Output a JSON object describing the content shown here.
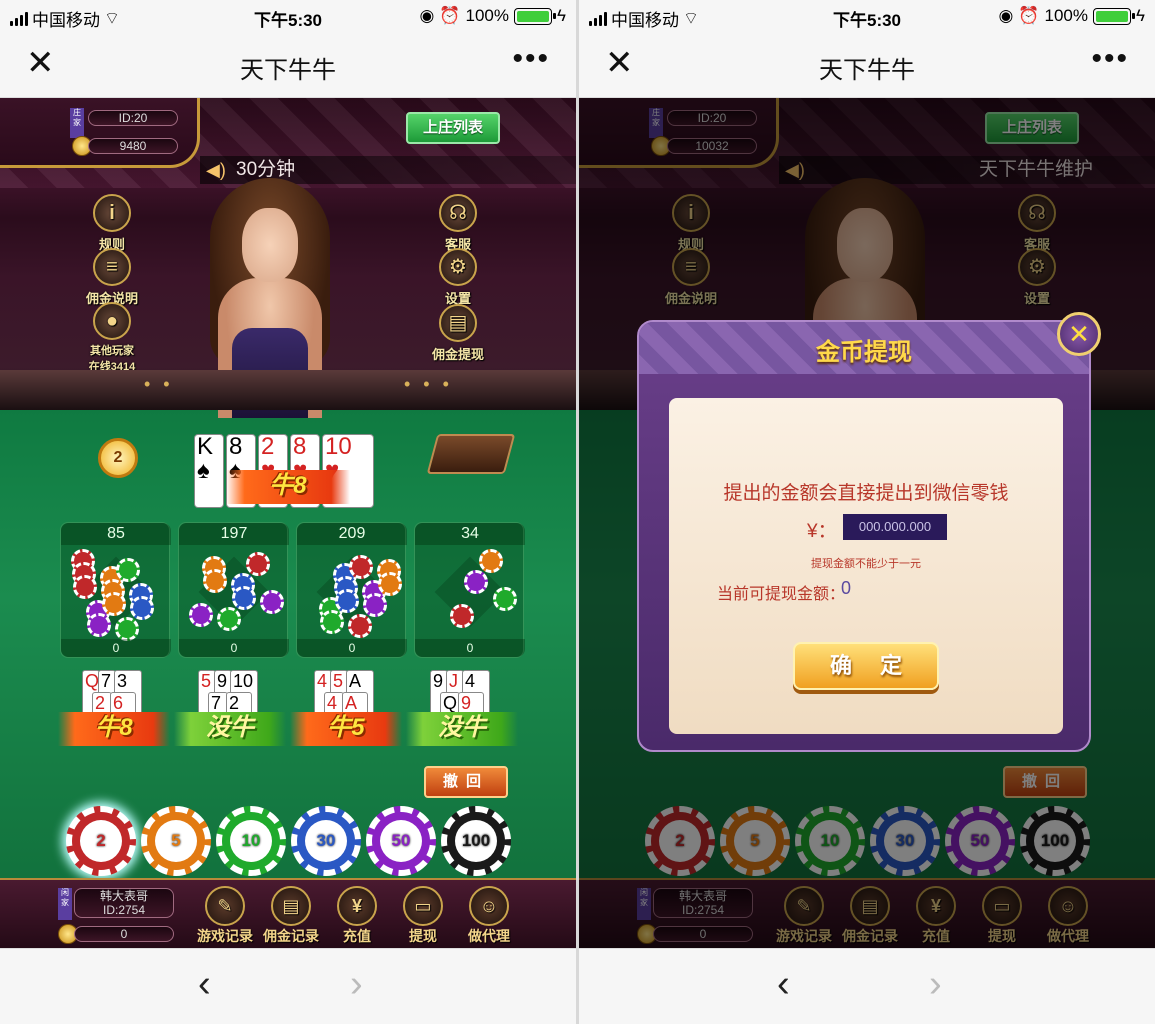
{
  "status": {
    "carrier": "中国移动",
    "time": "下午5:30",
    "battery": "100%"
  },
  "nav": {
    "title": "天下牛牛",
    "close": "✕",
    "more": "•••"
  },
  "left": {
    "dealer": {
      "role": "庄家",
      "id": "ID:20",
      "gold": "9480"
    },
    "banker_list": "上庄列表",
    "marquee": "30分钟",
    "side_left": [
      {
        "label": "规则",
        "icon": "info-icon",
        "glyph": "i"
      },
      {
        "label": "佣金说明",
        "icon": "document-icon",
        "glyph": "≡"
      },
      {
        "label": "其他玩家",
        "icon": "players-icon",
        "glyph": "●"
      }
    ],
    "online": "在线3414",
    "side_right": [
      {
        "label": "客服",
        "icon": "headset-icon",
        "glyph": "☊"
      },
      {
        "label": "设置",
        "icon": "gear-icon",
        "glyph": "⚙"
      },
      {
        "label": "佣金提现",
        "icon": "withdraw-icon",
        "glyph": "▤"
      }
    ],
    "timer": "2",
    "banker_cards": [
      {
        "v": "K",
        "s": "♠",
        "red": false
      },
      {
        "v": "8",
        "s": "♠",
        "red": false
      },
      {
        "v": "2",
        "s": "♥",
        "red": true
      },
      {
        "v": "8",
        "s": "♥",
        "red": true
      },
      {
        "v": "10",
        "s": "♥",
        "red": true
      }
    ],
    "banker_result": "牛8",
    "areas": [
      {
        "total": "85",
        "mine": "0"
      },
      {
        "total": "197",
        "mine": "0"
      },
      {
        "total": "209",
        "mine": "0"
      },
      {
        "total": "34",
        "mine": "0"
      }
    ],
    "hands": [
      {
        "top": [
          "Q",
          "7",
          "3"
        ],
        "bottom": [
          "2",
          "6"
        ],
        "result": "牛8",
        "style": "red"
      },
      {
        "top": [
          "5",
          "9",
          "10"
        ],
        "bottom": [
          "7",
          "2"
        ],
        "result": "没牛",
        "style": "green"
      },
      {
        "top": [
          "4",
          "5",
          "A"
        ],
        "bottom": [
          "4",
          "A"
        ],
        "result": "牛5",
        "style": "red"
      },
      {
        "top": [
          "9",
          "J",
          "4"
        ],
        "bottom": [
          "Q",
          "9"
        ],
        "result": "没牛",
        "style": "green"
      }
    ],
    "undo": "撤回",
    "chips": [
      {
        "value": "2",
        "color": "#c0282a"
      },
      {
        "value": "5",
        "color": "#e27a12"
      },
      {
        "value": "10",
        "color": "#1faa2c"
      },
      {
        "value": "30",
        "color": "#2a58c4"
      },
      {
        "value": "50",
        "color": "#8a22c4"
      },
      {
        "value": "100",
        "color": "#1a1a1a"
      }
    ],
    "player": {
      "role": "闲家",
      "name": "韩大表哥",
      "id": "ID:2754",
      "gold": "0"
    },
    "bottom_menu": [
      {
        "label": "游戏记录",
        "icon": "feather-icon",
        "glyph": "✎"
      },
      {
        "label": "佣金记录",
        "icon": "record-icon",
        "glyph": "▤"
      },
      {
        "label": "充值",
        "icon": "money-bag-icon",
        "glyph": "¥"
      },
      {
        "label": "提现",
        "icon": "wallet-icon",
        "glyph": "▭"
      },
      {
        "label": "做代理",
        "icon": "agent-icon",
        "glyph": "☺"
      }
    ]
  },
  "right": {
    "dealer": {
      "role": "庄家",
      "id": "ID:20",
      "gold": "10032"
    },
    "banker_list": "上庄列表",
    "marquee": "天下牛牛维护",
    "dialog": {
      "title": "金币提现",
      "close": "✕",
      "message": "提出的金额会直接提出到微信零钱",
      "currency": "¥：",
      "amount_placeholder": "000.000.000",
      "hint": "提现金额不能少于一元",
      "available_label": "当前可提现金额：",
      "available_value": "0",
      "confirm": "确定"
    }
  },
  "browser": {
    "back": "‹",
    "forward": "›"
  }
}
